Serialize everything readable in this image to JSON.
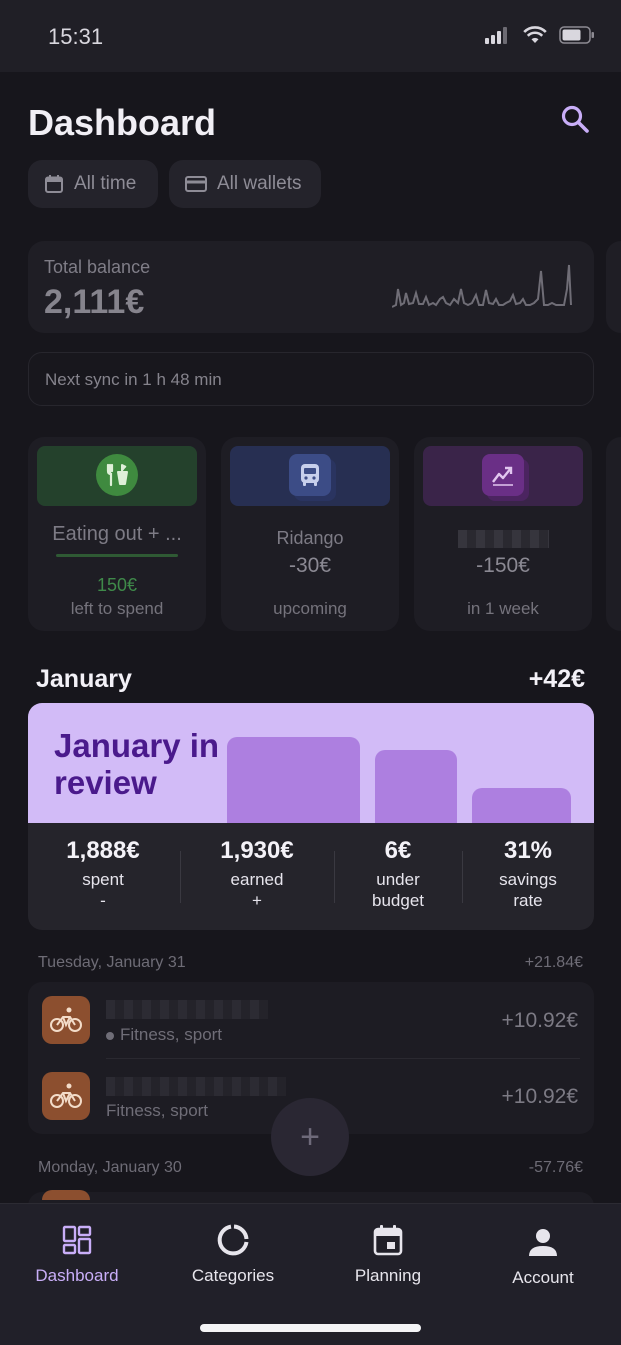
{
  "status_bar": {
    "time": "15:31"
  },
  "header": {
    "title": "Dashboard"
  },
  "filters": {
    "period": "All time",
    "wallets": "All wallets"
  },
  "balance": {
    "label": "Total balance",
    "value": "2,111€"
  },
  "sync": {
    "text": "Next sync in 1 h 48 min"
  },
  "tiles": [
    {
      "title": "Eating out + ...",
      "amount": "150€",
      "sub": "left to spend",
      "head_color": "#24412c",
      "icon_bg": "#3f8a3f",
      "amount_color": "#3f8a4a",
      "progress_color": "#2f5a34"
    },
    {
      "title": "Ridango",
      "amount": "-30€",
      "sub": "upcoming",
      "head_color": "#272f52",
      "icon_bg": "#3c4c86"
    },
    {
      "title": "",
      "amount": "-150€",
      "sub": "in 1 week",
      "head_color": "#3a2449",
      "icon_bg": "#6a2f86"
    }
  ],
  "month": {
    "title": "January",
    "delta": "+42€",
    "review_title": "January in review",
    "stats": [
      {
        "value": "1,888€",
        "label": "spent",
        "sub": "-"
      },
      {
        "value": "1,930€",
        "label": "earned",
        "sub": "+"
      },
      {
        "value": "6€",
        "label": "under",
        "sub": "budget"
      },
      {
        "value": "31%",
        "label": "savings",
        "sub": "rate"
      }
    ]
  },
  "transactions": [
    {
      "date": "Tuesday, January 31",
      "total": "+21.84€",
      "items": [
        {
          "category": "Fitness, sport",
          "amount": "+10.92€",
          "pending": true
        },
        {
          "category": "Fitness, sport",
          "amount": "+10.92€",
          "pending": false
        }
      ]
    },
    {
      "date": "Monday, January 30",
      "total": "-57.76€",
      "items": []
    }
  ],
  "fab": {
    "label": "+"
  },
  "nav": [
    {
      "label": "Dashboard",
      "icon": "dashboard-icon",
      "active": true
    },
    {
      "label": "Categories",
      "icon": "donut-chart-icon",
      "active": false
    },
    {
      "label": "Planning",
      "icon": "calendar-icon",
      "active": false
    },
    {
      "label": "Account",
      "icon": "person-icon",
      "active": false
    }
  ],
  "colors": {
    "accent": "#c9aef8",
    "review_banner": "#d2bbf7",
    "review_title": "#4a1a8c",
    "background": "#17161c"
  }
}
